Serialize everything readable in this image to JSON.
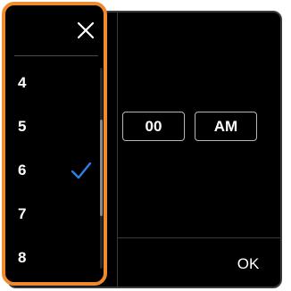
{
  "colors": {
    "accent_orange": "#f08a2c",
    "check_blue": "#2f7fe8",
    "background": "#000000",
    "text": "#ffffff"
  },
  "time_fields": {
    "minute": "00",
    "ampm": "AM"
  },
  "actions": {
    "ok_label": "OK"
  },
  "hour_picker": {
    "close_icon": "close-icon",
    "selected": "6",
    "items": [
      {
        "label": "4",
        "selected": false
      },
      {
        "label": "5",
        "selected": false
      },
      {
        "label": "6",
        "selected": true
      },
      {
        "label": "7",
        "selected": false
      },
      {
        "label": "8",
        "selected": false
      }
    ]
  }
}
